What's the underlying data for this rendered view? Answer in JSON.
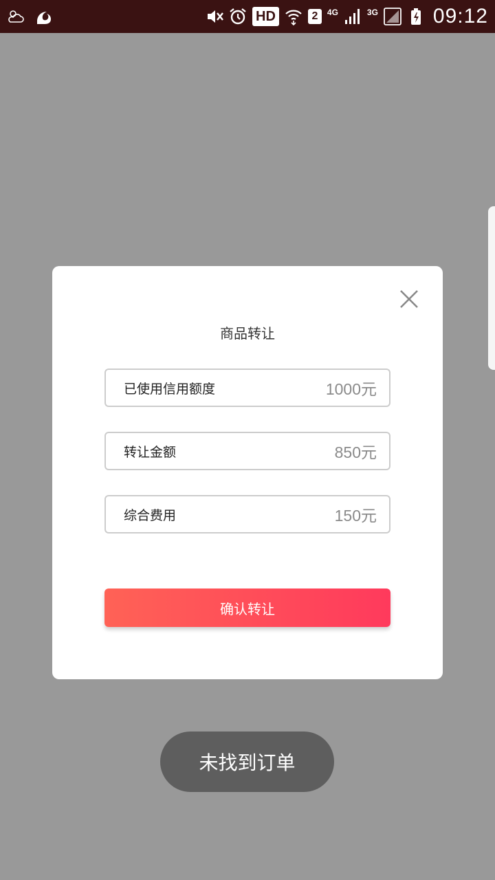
{
  "status_bar": {
    "hd_label": "HD",
    "sim_label": "2",
    "net1_label": "4G",
    "net2_label": "3G",
    "time": "09:12",
    "icons": [
      "weather-icon",
      "uc-browser-icon",
      "mute-icon",
      "alarm-icon",
      "wifi-icon",
      "signal-icon",
      "battery-icon"
    ]
  },
  "dialog": {
    "title": "商品转让",
    "fields": [
      {
        "label": "已使用信用额度",
        "value": "1000元"
      },
      {
        "label": "转让金额",
        "value": "850元"
      },
      {
        "label": "综合费用",
        "value": "150元"
      }
    ],
    "confirm_label": "确认转让"
  },
  "toast": {
    "text": "未找到订单"
  },
  "colors": {
    "status_bar_bg": "#3a1212",
    "overlay_bg": "#999999",
    "button_gradient_start": "#ff6256",
    "button_gradient_end": "#ff3a5c",
    "toast_bg": "#5e5e5e"
  }
}
